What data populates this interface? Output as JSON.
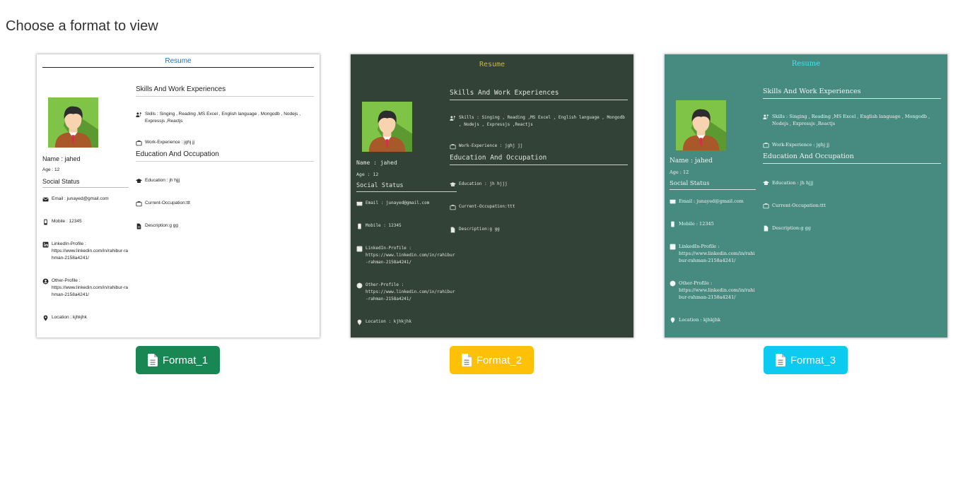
{
  "heading": "Choose a format to view",
  "resume": {
    "title": "Resume",
    "name": "Name : jahed",
    "age": "Age : 12",
    "social_heading": "Social Status",
    "email": "Email : junayed@gmail.com",
    "mobile": "Mobile : 12345",
    "linkedin_label": "LinkedIn-Profile :",
    "linkedin_url": "https://www.linkedin.com/in/rahibur-rahman-2158a4241/",
    "other_label": "Other-Profile :",
    "other_url": "https://www.linkedin.com/in/rahibur-rahman-2158a4241/",
    "location": "Location : kjhkjhk",
    "skills_heading": "Skills And Work Experiences",
    "skills": "Skills : Singing , Reading ,MS Excel , English language , Mongodb , Nodejs , Expressjs ,Reactjs",
    "work": "Work-Experience : jghj jj",
    "edu_heading": "Education And Occupation",
    "education": "Education : jh hjjj",
    "occupation": "Current-Occupation:ttt",
    "description": "Description:g gg"
  },
  "buttons": {
    "format_1": "Format_1",
    "format_2": "Format_2",
    "format_3": "Format_3"
  },
  "colors": {
    "format_1_button": "#198754",
    "format_2_button": "#ffc107",
    "format_3_button": "#0dcaf0",
    "format_2_card": "#334236",
    "format_3_card": "#478a80"
  },
  "icons": {
    "button": "file-text-icon",
    "skills": "user-skills-icon",
    "work": "briefcase-icon",
    "education": "graduation-cap-icon",
    "occupation": "briefcase-icon",
    "description": "file-icon",
    "email": "envelope-icon",
    "mobile": "mobile-icon",
    "linkedin": "linkedin-icon",
    "other": "user-circle-icon",
    "location": "map-marker-icon"
  }
}
